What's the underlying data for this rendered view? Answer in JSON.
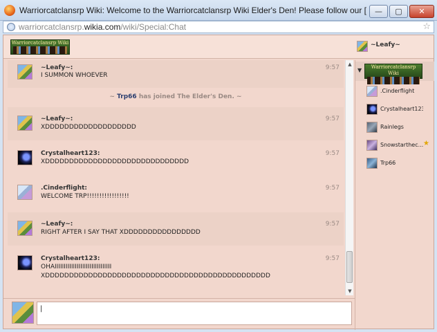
{
  "window": {
    "title": "Warriorcatclansrp Wiki: Welcome to the Warriorcatclansrp Wiki Elder's Den! Please follow our [[Rules for t...",
    "minimize": "—",
    "maximize": "▢",
    "close": "✕"
  },
  "address": {
    "pre": "warriorcatclansrp.",
    "host": "wikia.com",
    "path": "/wiki/Special:Chat"
  },
  "header": {
    "logo_text": "Warriorcatclansrp Wiki",
    "current_user": "~Leafy~"
  },
  "messages": [
    {
      "author": "~Leafy~:",
      "text": "I SUMMON WHOEVER",
      "time": "9:57",
      "avatar": "leafy"
    },
    {
      "alert_user": "Trp66",
      "alert_prefix": "~ ",
      "alert_text": " has joined The Elder's Den. ~"
    },
    {
      "author": "~Leafy~:",
      "text": "XDDDDDDDDDDDDDDDDDDD",
      "time": "9:57",
      "avatar": "leafy"
    },
    {
      "author": "Crystalheart123:",
      "text": "XDDDDDDDDDDDDDDDDDDDDDDDDDDDDDD",
      "time": "9:57",
      "avatar": "crystal"
    },
    {
      "author": ".Cinderflight:",
      "text": "WELCOME TRP!!!!!!!!!!!!!!!!!",
      "time": "9:57",
      "avatar": "cinder"
    },
    {
      "author": "~Leafy~:",
      "text": "RIGHT AFTER I SAY THAT XDDDDDDDDDDDDDDDD",
      "time": "9:57",
      "avatar": "leafy"
    },
    {
      "author": "Crystalheart123:",
      "text1": "OHAIIIIIIIIIIIIIIIIIIIIIIIIIIIIIII",
      "text2": "XDDDDDDDDDDDDDDDDDDDDDDDDDDDDDDDDDDDDDDDDDDDDDDD",
      "time": "9:57",
      "avatar": "crystal"
    }
  ],
  "userlist": {
    "room_logo_text": "Warriorcatclansrp Wiki",
    "toggle": "▼",
    "users": [
      {
        "name": ".Cinderflight",
        "avatar": "cinder"
      },
      {
        "name": "Crystalheart123",
        "avatar": "crystal"
      },
      {
        "name": "Rainlegs",
        "avatar": "rain"
      },
      {
        "name": "Snowstarthec...",
        "avatar": "snow",
        "star": "★"
      },
      {
        "name": "Trp66",
        "avatar": "trp"
      }
    ]
  },
  "input": {
    "value": "|"
  },
  "scrollbar": {
    "up": "▲",
    "down": "▼"
  }
}
